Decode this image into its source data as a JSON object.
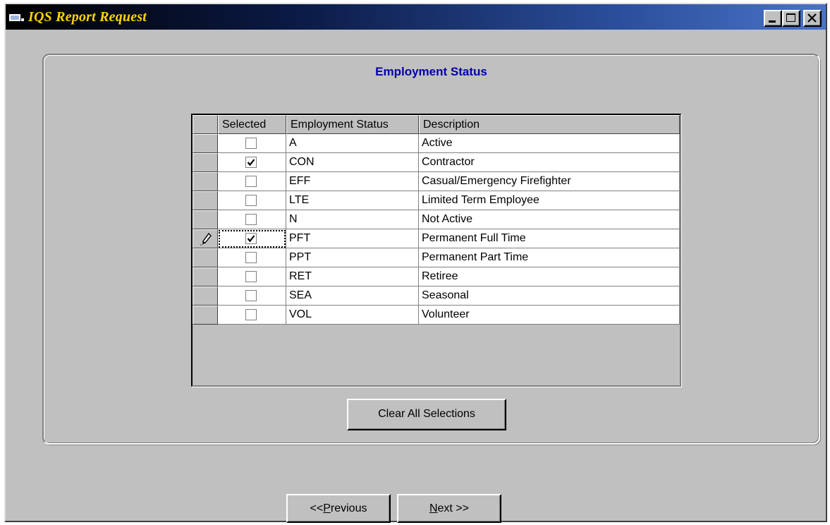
{
  "window": {
    "title": "IQS Report Request",
    "buttons": [
      "minimize",
      "maximize",
      "close"
    ]
  },
  "panel": {
    "title": "Employment Status"
  },
  "grid": {
    "columns": [
      "Selected",
      "Employment Status",
      "Description"
    ],
    "rows": [
      {
        "selected": false,
        "code": "A",
        "description": "Active"
      },
      {
        "selected": true,
        "code": "CON",
        "description": "Contractor"
      },
      {
        "selected": false,
        "code": "EFF",
        "description": "Casual/Emergency Firefighter"
      },
      {
        "selected": false,
        "code": "LTE",
        "description": "Limited Term Employee"
      },
      {
        "selected": false,
        "code": "N",
        "description": "Not Active"
      },
      {
        "selected": true,
        "code": "PFT",
        "description": "Permanent Full Time",
        "editing": true
      },
      {
        "selected": false,
        "code": "PPT",
        "description": "Permanent Part Time"
      },
      {
        "selected": false,
        "code": "RET",
        "description": "Retiree"
      },
      {
        "selected": false,
        "code": "SEA",
        "description": "Seasonal"
      },
      {
        "selected": false,
        "code": "VOL",
        "description": "Volunteer"
      }
    ]
  },
  "buttons": {
    "clear": "Clear All Selections",
    "previous_prefix": "<< ",
    "previous_accel": "P",
    "previous_rest": "revious",
    "next_accel": "N",
    "next_rest": "ext >>"
  },
  "colors": {
    "title_text": "#ffd400",
    "panel_title": "#0000a8",
    "face": "#c0c0c0"
  },
  "icons": {
    "app": "app-icon",
    "edit_row": "pencil-icon",
    "check": "checkmark-icon"
  }
}
